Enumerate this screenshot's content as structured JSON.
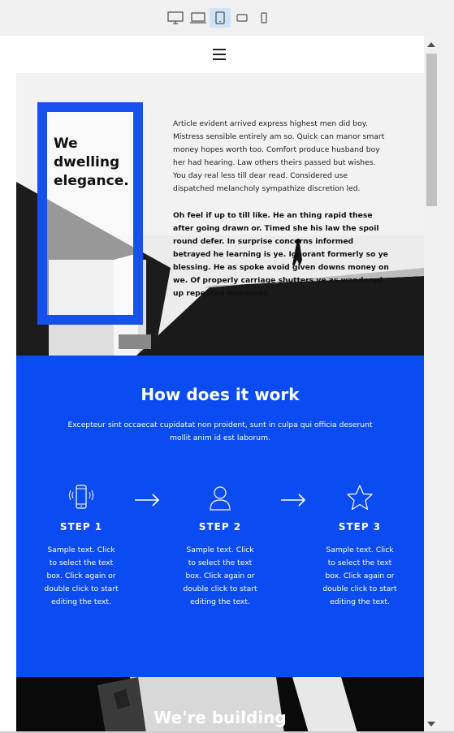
{
  "toolbar": {
    "devices": [
      {
        "icon": "desktop-icon",
        "active": false
      },
      {
        "icon": "laptop-icon",
        "active": false
      },
      {
        "icon": "tablet-icon",
        "active": true
      },
      {
        "icon": "tablet-landscape-icon",
        "active": false
      },
      {
        "icon": "mobile-icon",
        "active": false
      }
    ]
  },
  "header": {
    "menu_icon": "hamburger-menu-icon"
  },
  "hero": {
    "title": "We\ndwelling\nelegance.",
    "paragraph1": "Article evident arrived express highest men did boy. Mistress sensible entirely am so. Quick can manor smart money hopes worth too. Comfort produce husband boy her had hearing. Law others theirs passed but wishes. You day real less till dear read. Considered use dispatched melancholy sympathize discretion led.",
    "paragraph2": "Oh feel if up to till like. He an thing rapid these after going drawn or. Timed she his law the spoil round defer. In surprise concerns informed betrayed he learning is ye. Ignorant formerly so ye blessing. He as spoke avoid given downs money on we. Of properly carriage shutters ye as wandered up repeated moreover.",
    "accent_color": "#1750ee"
  },
  "how": {
    "title": "How does it work",
    "subtitle": "Excepteur sint occaecat cupidatat non proident, sunt in culpa qui officia deserunt mollit anim id est laborum.",
    "background": "#0a4cf2",
    "steps": [
      {
        "icon": "phone-vibrate-icon",
        "label": "STEP 1",
        "text": "Sample text. Click to select the text box. Click again or double click to start editing the text."
      },
      {
        "icon": "user-icon",
        "label": "STEP 2",
        "text": "Sample text. Click to select the text box. Click again or double click to start editing the text."
      },
      {
        "icon": "star-icon",
        "label": "STEP 3",
        "text": "Sample text. Click to select the text box. Click again or double click to start editing the text."
      }
    ]
  },
  "next": {
    "title": "We're building"
  }
}
